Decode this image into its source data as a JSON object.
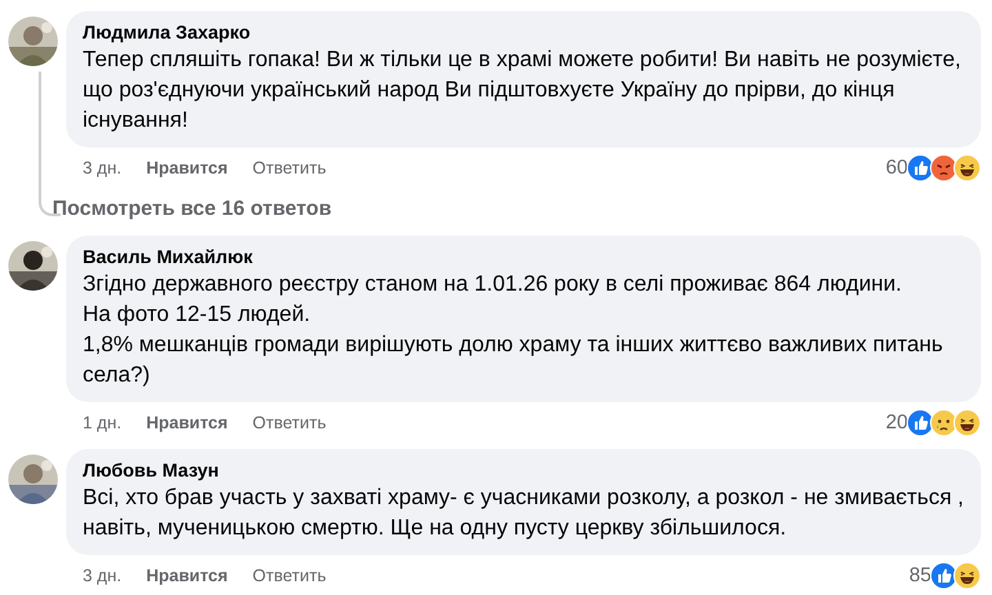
{
  "comments": [
    {
      "author": "Людмила Захарко",
      "text": "Тепер спляшіть гопака! Ви ж тільки це в храмі можете робити! Ви навіть не розумієте, що роз'єднуючи український народ Ви підштовхуєте Україну до прірви, до кінця існування!",
      "time": "3 дн.",
      "like": "Нравится",
      "reply": "Ответить",
      "count": "60",
      "reactions": [
        {
          "kind": "like"
        },
        {
          "kind": "angry"
        },
        {
          "kind": "haha"
        }
      ],
      "replies_link": "Посмотреть все 16 ответов"
    },
    {
      "author": "Василь Михайлюк",
      "text": "Згідно державного реєстру станом на 1.01.26 року в селі проживає 864 людини.\nНа фото 12-15 людей.\n1,8% мешканців громади вирішують долю храму та інших життєво важливих питань села?)",
      "time": "1 дн.",
      "like": "Нравится",
      "reply": "Ответить",
      "count": "20",
      "reactions": [
        {
          "kind": "like"
        },
        {
          "kind": "sad"
        },
        {
          "kind": "haha"
        }
      ]
    },
    {
      "author": "Любовь Мазун",
      "text": "Всі, хто брав участь у захваті храму- є учасниками розколу, а розкол - не змивається , навіть, мученицькою смертю. Ще на одну пусту церкву збільшилося.",
      "time": "3 дн.",
      "like": "Нравится",
      "reply": "Ответить",
      "count": "85",
      "reactions": [
        {
          "kind": "like"
        },
        {
          "kind": "haha"
        }
      ]
    }
  ]
}
